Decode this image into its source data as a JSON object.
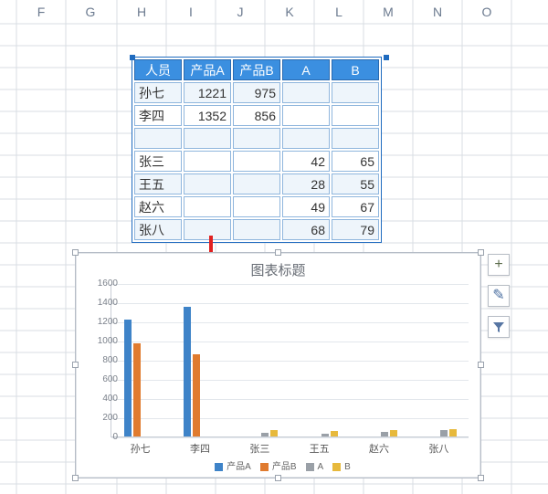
{
  "columns": [
    "F",
    "G",
    "H",
    "I",
    "J",
    "K",
    "L",
    "M",
    "N",
    "O"
  ],
  "table": {
    "headers": [
      "人员",
      "产品A",
      "产品B",
      "A",
      "B"
    ],
    "rows": [
      {
        "name": "孙七",
        "pa": "1221",
        "pb": "975",
        "a": "",
        "b": ""
      },
      {
        "name": "李四",
        "pa": "1352",
        "pb": "856",
        "a": "",
        "b": ""
      },
      {
        "name": "",
        "pa": "",
        "pb": "",
        "a": "",
        "b": ""
      },
      {
        "name": "张三",
        "pa": "",
        "pb": "",
        "a": "42",
        "b": "65"
      },
      {
        "name": "王五",
        "pa": "",
        "pb": "",
        "a": "28",
        "b": "55"
      },
      {
        "name": "赵六",
        "pa": "",
        "pb": "",
        "a": "49",
        "b": "67"
      },
      {
        "name": "张八",
        "pa": "",
        "pb": "",
        "a": "68",
        "b": "79"
      }
    ]
  },
  "chart_data": {
    "type": "bar",
    "title": "图表标题",
    "categories": [
      "孙七",
      "李四",
      "张三",
      "王五",
      "赵六",
      "张八"
    ],
    "series": [
      {
        "name": "产品A",
        "color": "#3e83c8",
        "values": [
          1221,
          1352,
          null,
          null,
          null,
          null
        ]
      },
      {
        "name": "产品B",
        "color": "#e07b2f",
        "values": [
          975,
          856,
          null,
          null,
          null,
          null
        ]
      },
      {
        "name": "A",
        "color": "#9aa0a7",
        "values": [
          null,
          null,
          42,
          28,
          49,
          68
        ]
      },
      {
        "name": "B",
        "color": "#e7b93c",
        "values": [
          null,
          null,
          65,
          55,
          67,
          79
        ]
      }
    ],
    "ylim": [
      0,
      1600
    ],
    "yticks": [
      0,
      200,
      400,
      600,
      800,
      1000,
      1200,
      1400,
      1600
    ],
    "xlabel": "",
    "ylabel": ""
  },
  "side_buttons": [
    "+",
    "✎",
    "▾"
  ],
  "colors": {
    "series": [
      "#3e83c8",
      "#e07b2f",
      "#9aa0a7",
      "#e7b93c"
    ]
  }
}
